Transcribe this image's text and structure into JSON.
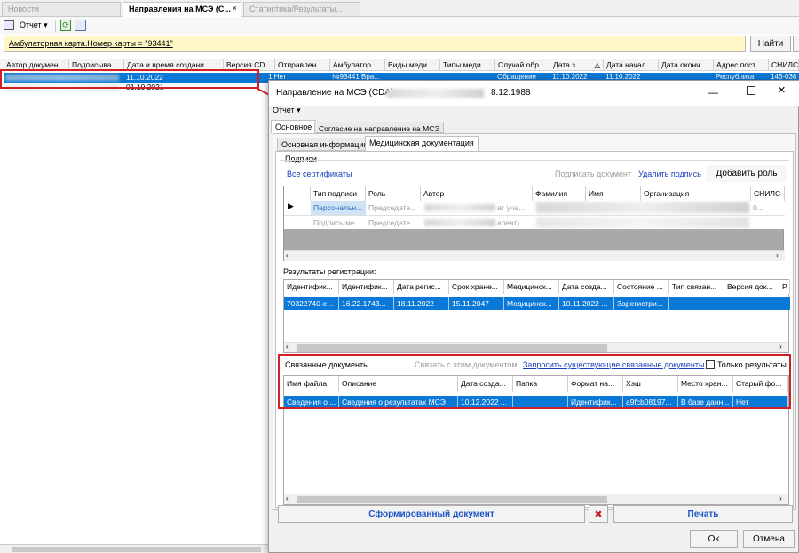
{
  "tabs": [
    {
      "label": "Новости"
    },
    {
      "label": "Направления на МСЭ (С...",
      "close": "×"
    },
    {
      "label": "Статистика/Результаты..."
    }
  ],
  "toolbar": {
    "report_label": "Отчет"
  },
  "filter": {
    "text": "Амбулаторная карта.Номер карты = \"93441\"",
    "find_label": "Найти"
  },
  "main_columns": [
    "Автор докумен...",
    "Подписыва...",
    "Дата и время создани...",
    "Версия CD...",
    "Отправлен ...",
    "Амбулатор...",
    "Виды меди...",
    "Типы меди...",
    "Случай обр...",
    "Дата з...",
    "Дата начал...",
    "Дата оконч...",
    "Адрес пост...",
    "СНИЛС"
  ],
  "main_rows": [
    {
      "date": "11.10.2022",
      "flag": "1 Нет",
      "amb": "№93441 Вра...",
      "case": "Обращение",
      "d1": "11.10.2022",
      "d2": "11.10.2022",
      "addr": "Республика",
      "snils": "146-036"
    },
    {
      "date": "01.10.2021"
    }
  ],
  "dialog": {
    "title": "Направление на МСЭ (CDA) -",
    "title_tail": "8.12.1988",
    "report_label": "Отчет",
    "tabs": [
      {
        "label": "Основное"
      },
      {
        "label": "Согласие на направление на МСЭ"
      }
    ],
    "subtabs": [
      {
        "label": "Основная информация"
      },
      {
        "label": "Медицинская документация"
      }
    ],
    "signatures": {
      "legend": "Подписи",
      "all_certs": "Все сертификаты",
      "sign_doc": "Подписать документ",
      "delete_sign": "Удалить подпись",
      "add_role": "Добавить роль",
      "columns": [
        "Тип подписи",
        "Роль",
        "Автор",
        "Фамилия",
        "Имя",
        "Организация",
        "СНИЛС"
      ],
      "rows": [
        {
          "type": "Персональн...",
          "role": "Председате...",
          "author_tail": "ат уча...",
          "snils": "0..."
        },
        {
          "type": "Подпись ме...",
          "role": "Председате...",
          "author_tail": "апевт)"
        }
      ]
    },
    "results": {
      "label": "Результаты регистрации:",
      "columns": [
        "Идентифик...",
        "Идентифик...",
        "Дата регис...",
        "Срок хране...",
        "Медицинск...",
        "Дата созда...",
        "Состояние ...",
        "Тип связан...",
        "Версия док...",
        "Р"
      ],
      "row": [
        "70322740-e...",
        "16.22.1743...",
        "18.11.2022",
        "15.11.2047",
        "Медицинск...",
        "10.11.2022 ...",
        "Зарегистри...",
        "",
        "",
        ""
      ]
    },
    "linked": {
      "label": "Связанные документы",
      "link_doc": "Связать с этим документом",
      "request_docs": "Запросить существующие связанные документы",
      "only_results": "Только результаты",
      "columns": [
        "Имя файла",
        "Описание",
        "Дата созда...",
        "Папка",
        "Формат на...",
        "Хэш",
        "Место хран...",
        "Старый фо..."
      ],
      "row": [
        "Сведения о ...",
        "Сведения о результатах МСЭ",
        "10.12.2022 ...",
        "",
        "Идентифик...",
        "a9fcb08197...",
        "В базе данн...",
        "Нет"
      ]
    },
    "generated_doc": "Сформированный документ",
    "print": "Печать",
    "ok": "Ok",
    "cancel": "Отмена"
  },
  "colors": {
    "selection": "#0a78d7",
    "highlight": "#d21f26",
    "filter_bg": "#fff8c6",
    "link": "#1a3fbf"
  }
}
